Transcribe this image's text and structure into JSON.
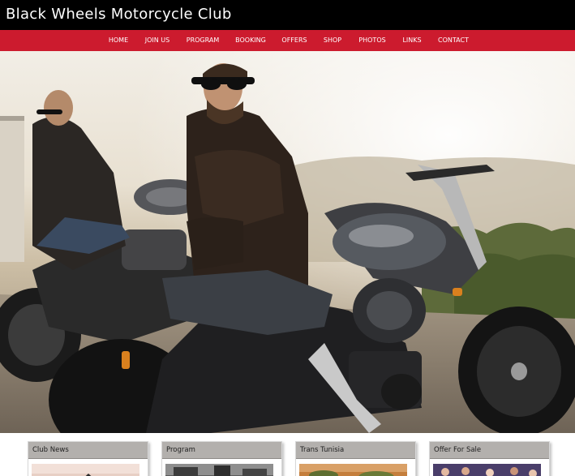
{
  "site": {
    "title": "Black Wheels Motorcycle Club"
  },
  "nav": [
    {
      "label": "HOME"
    },
    {
      "label": "JOIN US"
    },
    {
      "label": "PROGRAM"
    },
    {
      "label": "BOOKING"
    },
    {
      "label": "OFFERS"
    },
    {
      "label": "SHOP"
    },
    {
      "label": "PHOTOS"
    },
    {
      "label": "LINKS"
    },
    {
      "label": "CONTACT"
    }
  ],
  "hero": {
    "image": "two-bikers-on-motorcycles-photo"
  },
  "cards": [
    {
      "title": "Club News",
      "thumb": "bike-rider-photo"
    },
    {
      "title": "Program",
      "thumb": "street-photo"
    },
    {
      "title": "Trans Tunisia",
      "thumb": "desert-photo"
    },
    {
      "title": "Offer For Sale",
      "thumb": "crowd-photo"
    }
  ],
  "colors": {
    "header_bg": "#000000",
    "nav_bg": "#cc1b2e",
    "card_header_bg": "#b3b0ad"
  }
}
